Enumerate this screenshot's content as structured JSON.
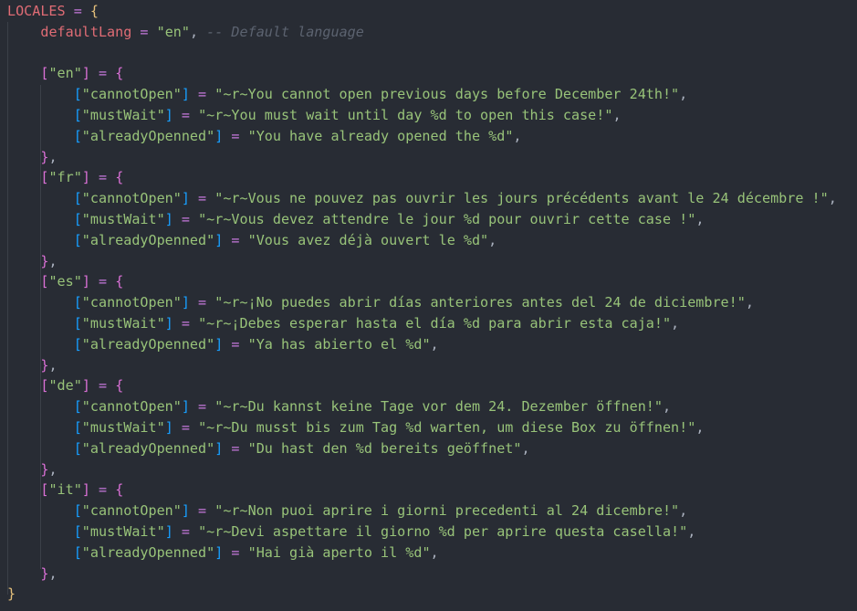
{
  "editor": {
    "table_name": "LOCALES",
    "default_key": "defaultLang",
    "default_value": "en",
    "comment": "-- Default language",
    "locales": [
      {
        "code": "en",
        "entries": [
          {
            "key": "cannotOpen",
            "value": "~r~You cannot open previous days before December 24th!"
          },
          {
            "key": "mustWait",
            "value": "~r~You must wait until day %d to open this case!"
          },
          {
            "key": "alreadyOpenned",
            "value": "You have already opened the %d"
          }
        ]
      },
      {
        "code": "fr",
        "entries": [
          {
            "key": "cannotOpen",
            "value": "~r~Vous ne pouvez pas ouvrir les jours précédents avant le 24 décembre !"
          },
          {
            "key": "mustWait",
            "value": "~r~Vous devez attendre le jour %d pour ouvrir cette case !"
          },
          {
            "key": "alreadyOpenned",
            "value": "Vous avez déjà ouvert le %d"
          }
        ]
      },
      {
        "code": "es",
        "entries": [
          {
            "key": "cannotOpen",
            "value": "~r~¡No puedes abrir días anteriores antes del 24 de diciembre!"
          },
          {
            "key": "mustWait",
            "value": "~r~¡Debes esperar hasta el día %d para abrir esta caja!"
          },
          {
            "key": "alreadyOpenned",
            "value": "Ya has abierto el %d"
          }
        ]
      },
      {
        "code": "de",
        "entries": [
          {
            "key": "cannotOpen",
            "value": "~r~Du kannst keine Tage vor dem 24. Dezember öffnen!"
          },
          {
            "key": "mustWait",
            "value": "~r~Du musst bis zum Tag %d warten, um diese Box zu öffnen!"
          },
          {
            "key": "alreadyOpenned",
            "value": "Du hast den %d bereits geöffnet"
          }
        ]
      },
      {
        "code": "it",
        "entries": [
          {
            "key": "cannotOpen",
            "value": "~r~Non puoi aprire i giorni precedenti al 24 dicembre!"
          },
          {
            "key": "mustWait",
            "value": "~r~Devi aspettare il giorno %d per aprire questa casella!"
          },
          {
            "key": "alreadyOpenned",
            "value": "Hai già aperto il %d"
          }
        ]
      }
    ]
  }
}
